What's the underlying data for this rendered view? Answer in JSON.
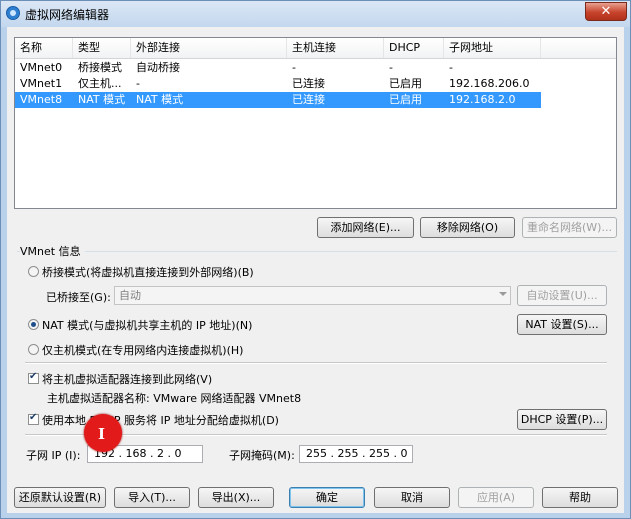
{
  "window": {
    "title": "虚拟网络编辑器",
    "close_glyph": "✕"
  },
  "table": {
    "columns": [
      "名称",
      "类型",
      "外部连接",
      "主机连接",
      "DHCP",
      "子网地址"
    ],
    "rows": [
      {
        "name": "VMnet0",
        "type": "桥接模式",
        "external": "自动桥接",
        "host": "-",
        "dhcp": "-",
        "subnet": "-"
      },
      {
        "name": "VMnet1",
        "type": "仅主机...",
        "external": "-",
        "host": "已连接",
        "dhcp": "已启用",
        "subnet": "192.168.206.0"
      },
      {
        "name": "VMnet8",
        "type": "NAT 模式",
        "external": "NAT 模式",
        "host": "已连接",
        "dhcp": "已启用",
        "subnet": "192.168.2.0"
      }
    ],
    "selected_row": "VMnet8"
  },
  "list_buttons": {
    "add": "添加网络(E)...",
    "remove": "移除网络(O)",
    "rename": "重命名网络(W)..."
  },
  "vmnet_info": {
    "group_title": "VMnet 信息",
    "bridged_label": "桥接模式(将虚拟机直接连接到外部网络)(B)",
    "bridged_to_label": "已桥接至(G):",
    "bridged_to_value": "自动",
    "auto_settings": "自动设置(U)...",
    "nat_label": "NAT 模式(与虚拟机共享主机的 IP 地址)(N)",
    "nat_settings": "NAT 设置(S)...",
    "hostonly_label": "仅主机模式(在专用网络内连接虚拟机)(H)",
    "selected_mode": "nat",
    "connect_adapter_label": "将主机虚拟适配器连接到此网络(V)",
    "connect_adapter_checked": true,
    "adapter_name_text": "主机虚拟适配器名称: VMware 网络适配器 VMnet8",
    "dhcp_label": "使用本地 DHCP 服务将 IP 地址分配给虚拟机(D)",
    "dhcp_checked": true,
    "dhcp_settings": "DHCP 设置(P)...",
    "subnet_ip_label": "子网 IP (I):",
    "subnet_ip_value": "192 . 168 . 2 . 0",
    "subnet_mask_label": "子网掩码(M):",
    "subnet_mask_value": "255 . 255 . 255 . 0"
  },
  "footer": {
    "restore_defaults": "还原默认设置(R)",
    "import": "导入(T)...",
    "export": "导出(X)...",
    "ok": "确定",
    "cancel": "取消",
    "apply": "应用(A)",
    "help": "帮助"
  },
  "cursor_icon": "text-ibeam-cursor",
  "colors": {
    "selection": "#3399ff",
    "click_marker": "#e21a1a",
    "close_button": "#c7432b"
  }
}
